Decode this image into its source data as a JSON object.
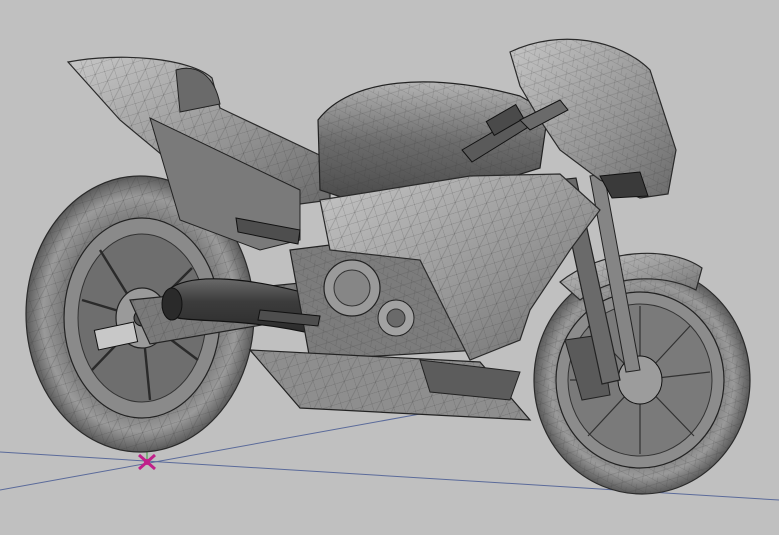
{
  "viewport": {
    "background_color": "#c0c0c0",
    "render_mode": "wireframe-on-shaded",
    "model_color": "#8c8c8c",
    "edge_color": "#2a2a2a",
    "axis_colors": {
      "ground_axis_1": "#5a6a9a",
      "ground_axis_2": "#5a6a9a",
      "up_axis": "#3a9a3a",
      "origin_marker": "#c0208a"
    },
    "icons": {
      "origin": "origin-marker-icon"
    }
  }
}
